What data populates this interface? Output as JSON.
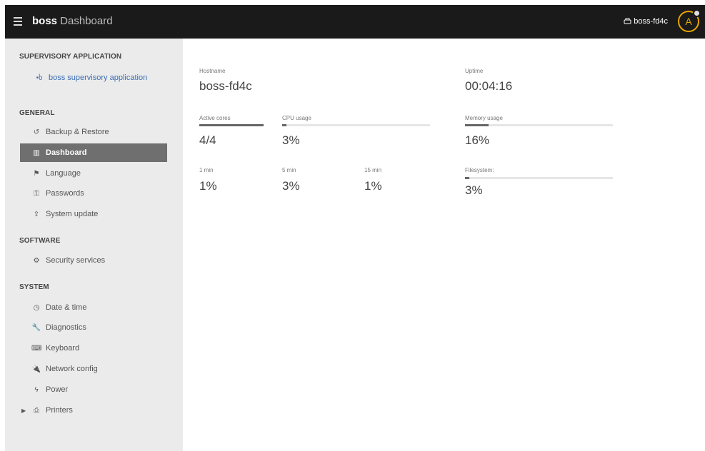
{
  "topbar": {
    "brand_bold": "boss",
    "brand_rest": " Dashboard",
    "hostname": "boss-fd4c",
    "avatar_letter": "A"
  },
  "sidebar": {
    "sections": {
      "supervisory": "SUPERVISORY APPLICATION",
      "general": "GENERAL",
      "software": "SOFTWARE",
      "system": "SYSTEM"
    },
    "items": {
      "supervisory_app": "boss supervisory application",
      "backup": "Backup & Restore",
      "dashboard": "Dashboard",
      "language": "Language",
      "passwords": "Passwords",
      "system_update": "System update",
      "security_services": "Security services",
      "date_time": "Date & time",
      "diagnostics": "Diagnostics",
      "keyboard": "Keyboard",
      "network_config": "Network config",
      "power": "Power",
      "printers": "Printers"
    }
  },
  "main": {
    "hostname": {
      "label": "Hostname",
      "value": "boss-fd4c"
    },
    "uptime": {
      "label": "Uptime",
      "value": "00:04:16"
    },
    "active_cores": {
      "label": "Active cores",
      "value": "4/4",
      "fill": 1.0
    },
    "cpu_usage": {
      "label": "CPU usage",
      "value": "3%",
      "fill": 0.03
    },
    "memory_usage": {
      "label": "Memory usage",
      "value": "16%",
      "fill": 0.16
    },
    "load_1": {
      "label": "1 min",
      "value": "1%"
    },
    "load_5": {
      "label": "5 min",
      "value": "3%"
    },
    "load_15": {
      "label": "15 min",
      "value": "1%"
    },
    "filesystem": {
      "label": "Filesystem:",
      "value": "3%",
      "fill": 0.03
    }
  },
  "colors": {
    "topbar": "#1a1a1a",
    "sidebar": "#ebebeb",
    "active_item": "#6f6f6f",
    "avatar_accent": "#e8a400",
    "link": "#3b6fb6"
  }
}
